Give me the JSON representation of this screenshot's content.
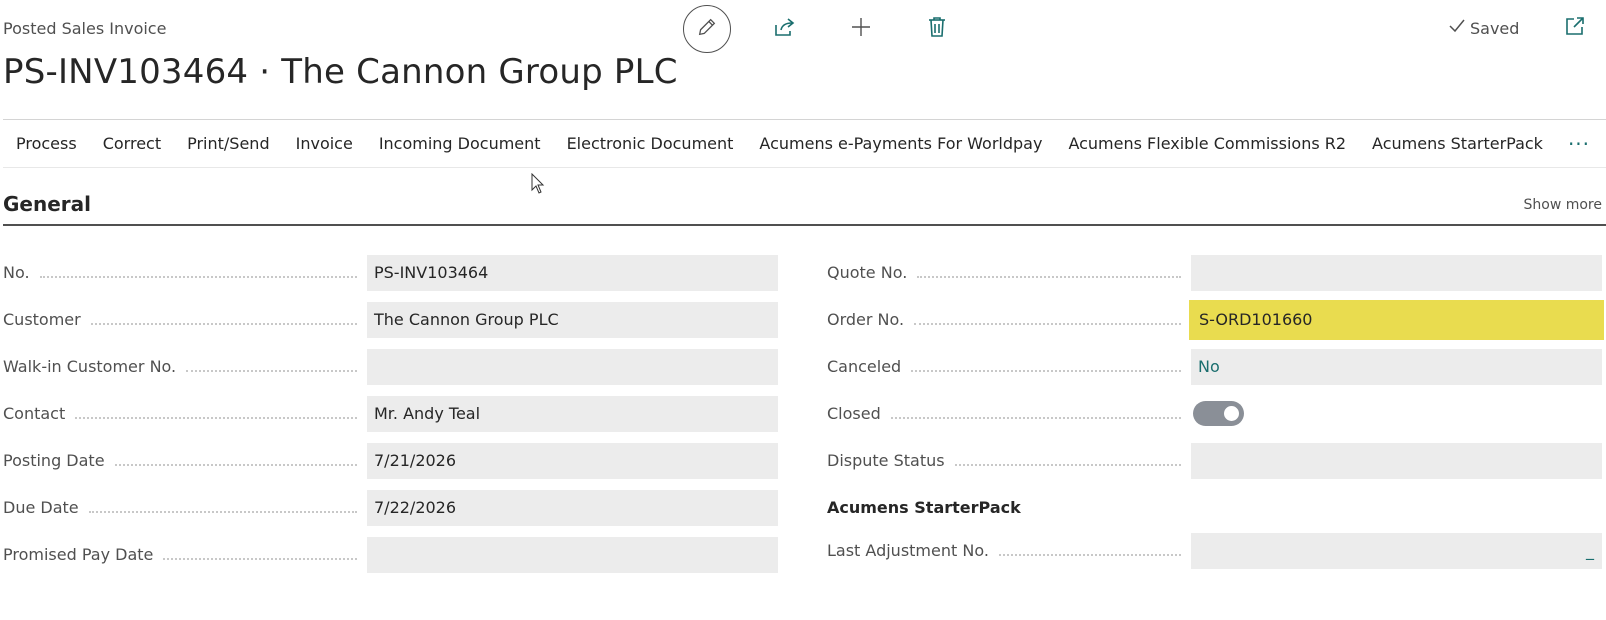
{
  "header": {
    "page_type": "Posted Sales Invoice",
    "title": "PS-INV103464 · The Cannon Group PLC",
    "saved_label": "Saved"
  },
  "icons": {
    "edit": "pencil-icon",
    "share": "share-icon",
    "new": "plus-icon",
    "delete": "trash-icon",
    "saved": "checkmark-icon",
    "popout": "popout-icon",
    "cursor": "mouse-pointer-icon"
  },
  "colors": {
    "accent": "#1a6e6e",
    "highlight": "#e9dc4f",
    "field_bg": "#ececec",
    "toggle_off": "#8a8f97"
  },
  "tabs": [
    {
      "label": "Process"
    },
    {
      "label": "Correct"
    },
    {
      "label": "Print/Send"
    },
    {
      "label": "Invoice"
    },
    {
      "label": "Incoming Document"
    },
    {
      "label": "Electronic Document"
    },
    {
      "label": "Acumens e-Payments For Worldpay"
    },
    {
      "label": "Acumens Flexible Commissions R2"
    },
    {
      "label": "Acumens StarterPack"
    }
  ],
  "tabs_more": "···",
  "general": {
    "title": "General",
    "show_more": "Show more",
    "left_fields": [
      {
        "label": "No.",
        "value": "PS-INV103464"
      },
      {
        "label": "Customer",
        "value": "The Cannon Group PLC"
      },
      {
        "label": "Walk-in Customer No.",
        "value": ""
      },
      {
        "label": "Contact",
        "value": "Mr. Andy Teal"
      },
      {
        "label": "Posting Date",
        "value": "7/21/2026"
      },
      {
        "label": "Due Date",
        "value": "7/22/2026"
      },
      {
        "label": "Promised Pay Date",
        "value": ""
      }
    ],
    "right_fields": {
      "quote_no": {
        "label": "Quote No.",
        "value": ""
      },
      "order_no": {
        "label": "Order No.",
        "value": "S-ORD101660"
      },
      "canceled": {
        "label": "Canceled",
        "value": "No"
      },
      "closed": {
        "label": "Closed",
        "value": "off"
      },
      "dispute_status": {
        "label": "Dispute Status",
        "value": ""
      },
      "starterpack_heading": "Acumens StarterPack",
      "last_adjustment_no": {
        "label": "Last Adjustment No.",
        "value": "",
        "lookup": "_"
      }
    }
  }
}
